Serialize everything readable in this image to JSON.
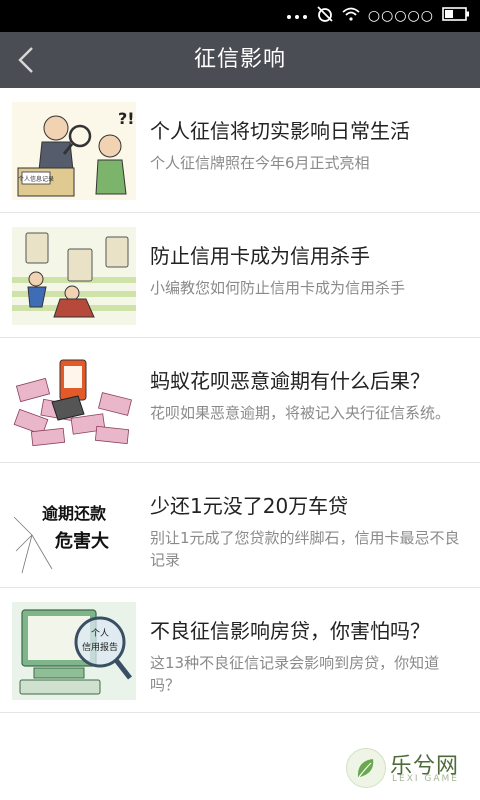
{
  "status_bar": {
    "signal_text": "○○○○○",
    "icons": [
      "more-icon",
      "alarm-off-icon",
      "wifi-icon",
      "signal-icon",
      "battery-icon"
    ]
  },
  "app_bar": {
    "title": "征信影响",
    "back_icon": "chevron-left-icon"
  },
  "articles": [
    {
      "title": "个人征信将切实影响日常生活",
      "desc": "个人征信牌照在今年6月正式亮相"
    },
    {
      "title": "防止信用卡成为信用杀手",
      "desc": "小编教您如何防止信用卡成为信用杀手"
    },
    {
      "title": "蚂蚁花呗恶意逾期有什么后果？",
      "desc": "花呗如果恶意逾期，将被记入央行征信系统。"
    },
    {
      "title": "少还1元没了20万车贷",
      "desc": "别让1元成了您贷款的绊脚石，信用卡最忌不良记录"
    },
    {
      "title": "不良征信影响房贷，你害怕吗？",
      "desc": "这13种不良征信记录会影响到房贷，你知道吗？"
    }
  ],
  "thumb_texts": {
    "t1_sign": "个人信息记录",
    "t4_line1": "逾期还款",
    "t4_line2": "危害大",
    "t5_line1": "个人",
    "t5_line2": "信用报告"
  },
  "watermark": {
    "text": "乐兮网",
    "sub": "LEXI GAME"
  }
}
